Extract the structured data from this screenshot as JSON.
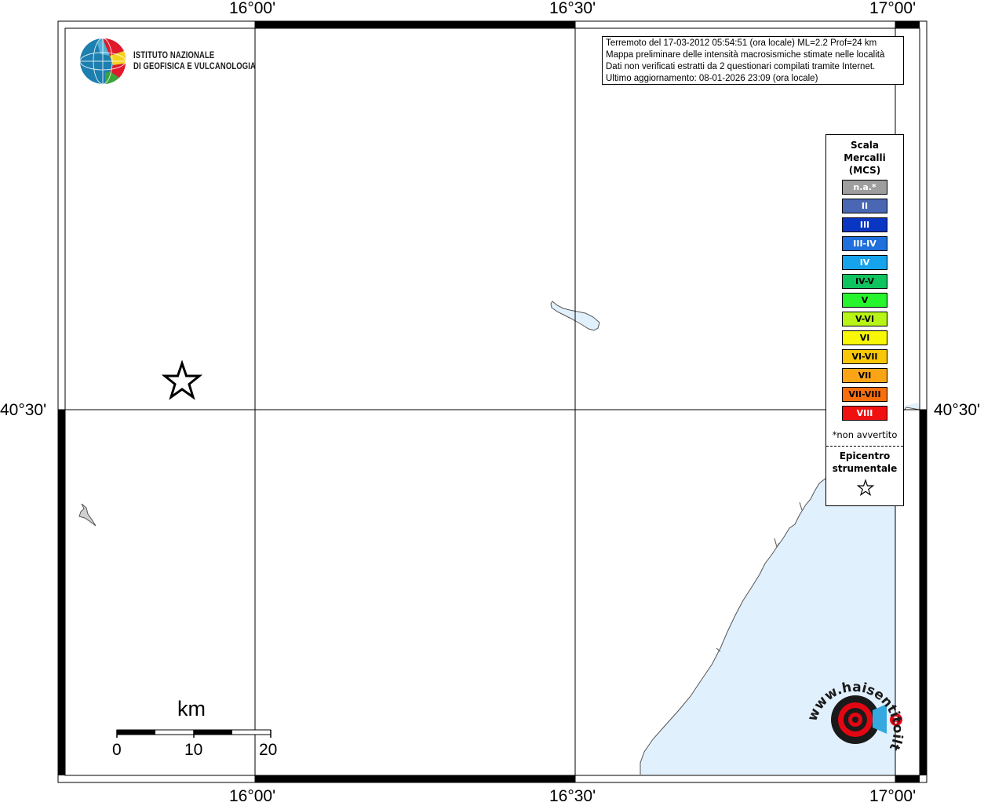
{
  "map": {
    "top_axis_labels": [
      "16°00'",
      "16°30'",
      "17°00'"
    ],
    "bottom_axis_labels": [
      "16°00'",
      "16°30'",
      "17°00'"
    ],
    "left_axis_label": "40°30'",
    "right_axis_label": "40°30'",
    "sea_color": "#e1f0fd",
    "coast_color": "#555555"
  },
  "info": {
    "line1": "Terremoto del 17-03-2012 05:54:51 (ora locale) ML=2.2 Prof=24 km",
    "line2": "Mappa preliminare delle intensità macrosismiche stimate nelle località",
    "line3": "Dati non verificati estratti da 2 questionari compilati tramite Internet.",
    "line4": "Ultimo aggiornamento: 08-01-2026 23:09 (ora locale)"
  },
  "institute": {
    "line1": "ISTITUTO NAZIONALE",
    "line2": "DI GEOFISICA E VULCANOLOGIA"
  },
  "legend": {
    "title_line1": "Scala",
    "title_line2": "Mercalli",
    "title_line3": "(MCS)",
    "items": [
      {
        "label": "n.a.*",
        "color": "#9e9e9e",
        "text_color": "#ffffff"
      },
      {
        "label": "II",
        "color": "#4a67b4",
        "text_color": "#ffffff"
      },
      {
        "label": "III",
        "color": "#0a36c4",
        "text_color": "#ffffff"
      },
      {
        "label": "III-IV",
        "color": "#1f6fdc",
        "text_color": "#ffffff"
      },
      {
        "label": "IV",
        "color": "#16a3ec",
        "text_color": "#ffffff"
      },
      {
        "label": "IV-V",
        "color": "#0fc45f",
        "text_color": "#000000"
      },
      {
        "label": "V",
        "color": "#26f52d",
        "text_color": "#000000"
      },
      {
        "label": "V-VI",
        "color": "#b7f516",
        "text_color": "#000000"
      },
      {
        "label": "VI",
        "color": "#f7f706",
        "text_color": "#000000"
      },
      {
        "label": "VI-VII",
        "color": "#f9c707",
        "text_color": "#000000"
      },
      {
        "label": "VII",
        "color": "#fba516",
        "text_color": "#000000"
      },
      {
        "label": "VII-VIII",
        "color": "#f76f0d",
        "text_color": "#000000"
      },
      {
        "label": "VIII",
        "color": "#f01010",
        "text_color": "#ffffff"
      }
    ],
    "note": "*non avvertito",
    "epicentre_line1": "Epicentro",
    "epicentre_line2": "strumentale"
  },
  "scalebar": {
    "unit": "km",
    "ticks": [
      "0",
      "10",
      "20"
    ]
  },
  "brand": {
    "text": "www.haisentitoilterremoto.it",
    "accent": "#e30613"
  }
}
